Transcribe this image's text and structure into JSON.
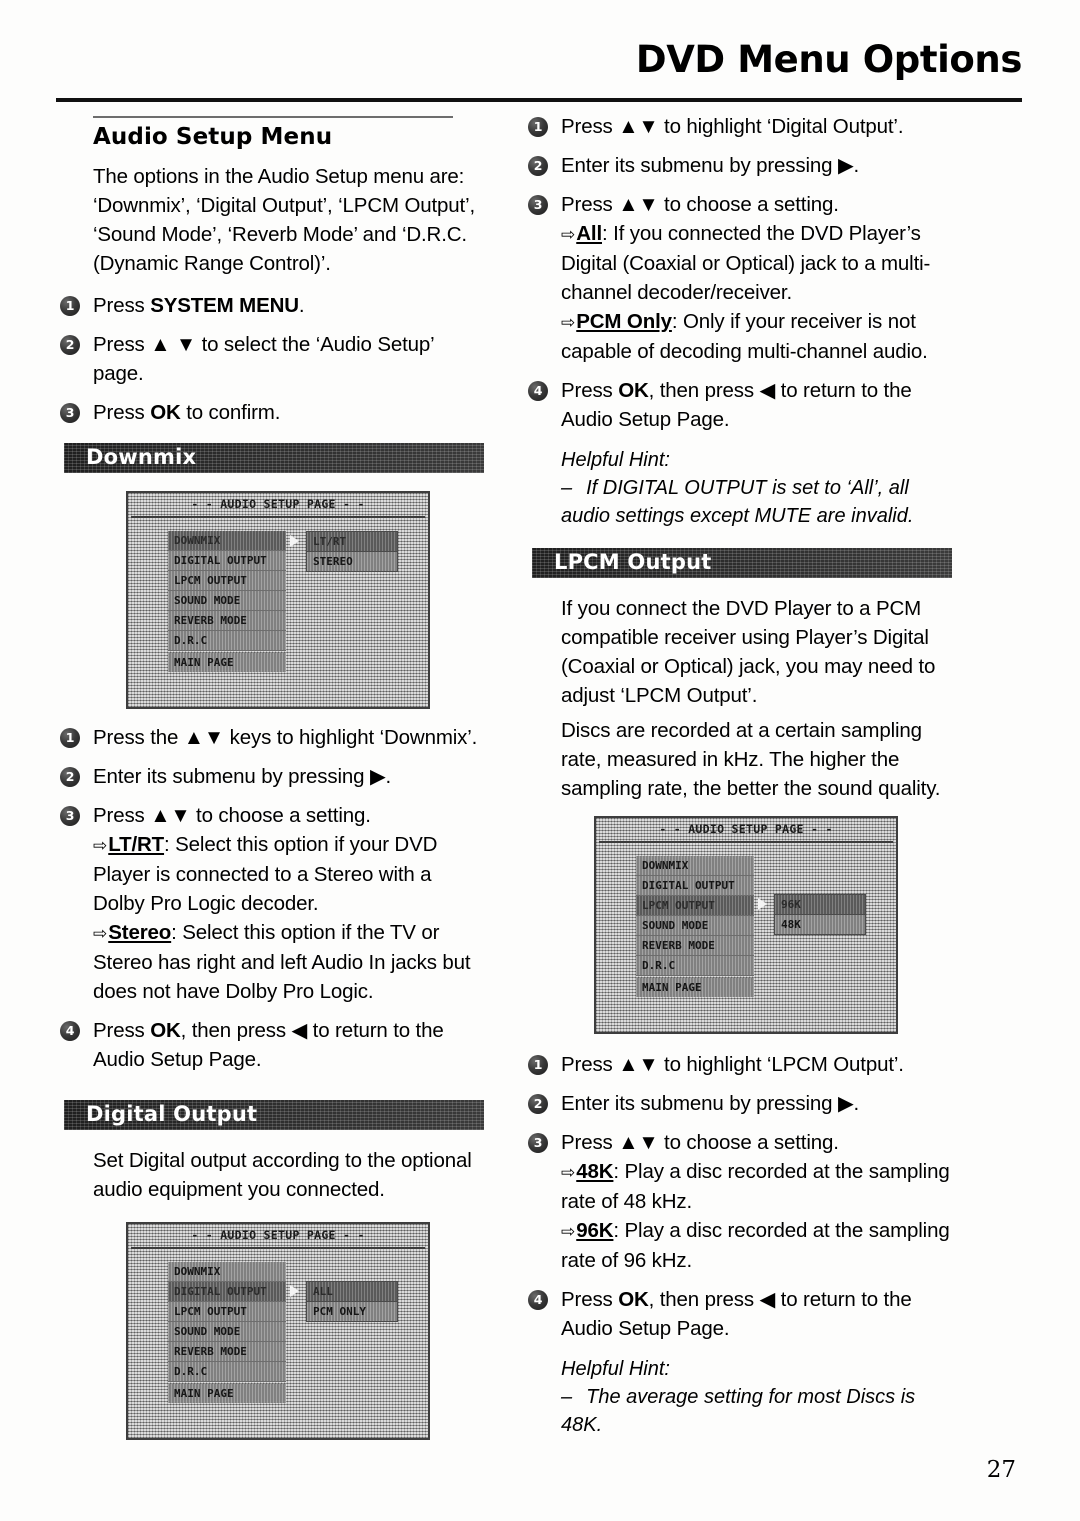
{
  "header": {
    "title": "DVD Menu Options"
  },
  "page_number": "27",
  "left_column": {
    "section_heading": "Audio Setup Menu",
    "intro_paragraph": "The options in the Audio Setup menu are: ‘Downmix’, ‘Digital Output’, ‘LPCM Output’, ‘Sound Mode’, ‘Reverb Mode’ and ‘D.R.C. (Dynamic Range Control)’.",
    "steps": [
      {
        "num": "1",
        "pre": "Press ",
        "strong": "SYSTEM MENU",
        "post": "."
      },
      {
        "num": "2",
        "pre": "Press ▲ ▼ to select the ‘Audio Setup’ page.",
        "strong": "",
        "post": ""
      },
      {
        "num": "3",
        "pre": "Press ",
        "strong": "OK",
        "post": " to confirm."
      }
    ],
    "downmix": {
      "bar_label": "Downmix",
      "osd": {
        "title": "- - AUDIO SETUP PAGE - -",
        "menu_items": [
          "DOWNMIX",
          "DIGITAL OUTPUT",
          "LPCM OUTPUT",
          "SOUND MODE",
          "REVERB MODE",
          "D.R.C"
        ],
        "selected_index": 0,
        "main_page_label": "MAIN PAGE",
        "submenu": [
          "LT/RT",
          "STEREO"
        ],
        "submenu_selected_index": 0
      },
      "steps": [
        {
          "num": "1",
          "text": "Press the ▲▼ keys to highlight ‘Downmix’."
        },
        {
          "num": "2",
          "text": "Enter its submenu by pressing ▶."
        },
        {
          "num": "3",
          "text": "Press ▲▼ to choose a setting."
        },
        {
          "num": "4",
          "text": "Press OK, then press ◀ to return to the Audio Setup Page."
        }
      ],
      "option_ltrt_key": "LT/RT",
      "option_ltrt_desc": ": Select this option if your DVD Player is connected to a Stereo with a Dolby Pro Logic decoder.",
      "option_stereo_key": "Stereo",
      "option_stereo_desc": ": Select this option if the TV or Stereo has right and left Audio In jacks but does not have Dolby Pro Logic.",
      "step3_label": "Press ▲▼ to choose a setting.",
      "step4_pre": "Press ",
      "step4_strong": "OK",
      "step4_post": ", then press ◀ to return to the Audio Setup Page."
    },
    "digital_output": {
      "bar_label": "Digital Output",
      "paragraph": "Set Digital output according to the optional audio equipment you connected.",
      "osd": {
        "title": "- - AUDIO SETUP PAGE - -",
        "menu_items": [
          "DOWNMIX",
          "DIGITAL OUTPUT",
          "LPCM OUTPUT",
          "SOUND MODE",
          "REVERB MODE",
          "D.R.C"
        ],
        "selected_index": 1,
        "main_page_label": "MAIN PAGE",
        "submenu": [
          "ALL",
          "PCM ONLY"
        ],
        "submenu_selected_index": 0
      }
    }
  },
  "right_column": {
    "digital_output_steps": {
      "step1": "Press ▲▼ to highlight ‘Digital Output’.",
      "step2": "Enter its submenu by pressing ▶.",
      "step3": "Press ▲▼ to choose a setting.",
      "option_all_key": "All",
      "option_all_desc": ": If you connected the DVD Player’s Digital (Coaxial or Optical) jack to a multi-channel decoder/receiver.",
      "option_pcm_key": "PCM Only",
      "option_pcm_desc": ": Only if your receiver is not capable of decoding multi-channel audio.",
      "step4_pre": "Press ",
      "step4_strong": "OK",
      "step4_post": ", then press ◀ to return to the Audio Setup Page.",
      "hint_title": "Helpful Hint:",
      "hint_dash": "–",
      "hint_text": "If DIGITAL OUTPUT is set to ‘All’, all audio settings except MUTE are invalid."
    },
    "lpcm": {
      "bar_label": "LPCM Output",
      "paragraph1": "If you connect the DVD Player to a PCM compatible receiver using Player’s Digital (Coaxial or Optical) jack, you may need to adjust ‘LPCM Output’.",
      "paragraph2": "Discs are recorded at a certain sampling rate, measured in kHz. The higher the sampling rate, the better the sound quality.",
      "osd": {
        "title": "- - AUDIO SETUP PAGE - -",
        "menu_items": [
          "DOWNMIX",
          "DIGITAL OUTPUT",
          "LPCM OUTPUT",
          "SOUND MODE",
          "REVERB MODE",
          "D.R.C"
        ],
        "selected_index": 2,
        "main_page_label": "MAIN PAGE",
        "submenu": [
          "96K",
          "48K"
        ],
        "submenu_selected_index": 0
      },
      "step1": "Press ▲▼ to highlight ‘LPCM Output’.",
      "step2": "Enter its submenu by pressing ▶.",
      "step3": "Press ▲▼ to choose a setting.",
      "option_48k_key": "48K",
      "option_48k_desc": ": Play a disc recorded at the sampling rate of 48 kHz.",
      "option_96k_key": "96K",
      "option_96k_desc": ": Play a disc recorded at the sampling rate of 96 kHz.",
      "step4_pre": "Press ",
      "step4_strong": "OK",
      "step4_post": ", then press ◀ to return to the Audio Setup Page.",
      "hint_title": "Helpful Hint:",
      "hint_dash": "–",
      "hint_text": "The average setting for most Discs is 48K."
    }
  },
  "icons": {
    "arrow_right": "⇨",
    "bullet_1": "1",
    "bullet_2": "2",
    "bullet_3": "3",
    "bullet_4": "4"
  }
}
